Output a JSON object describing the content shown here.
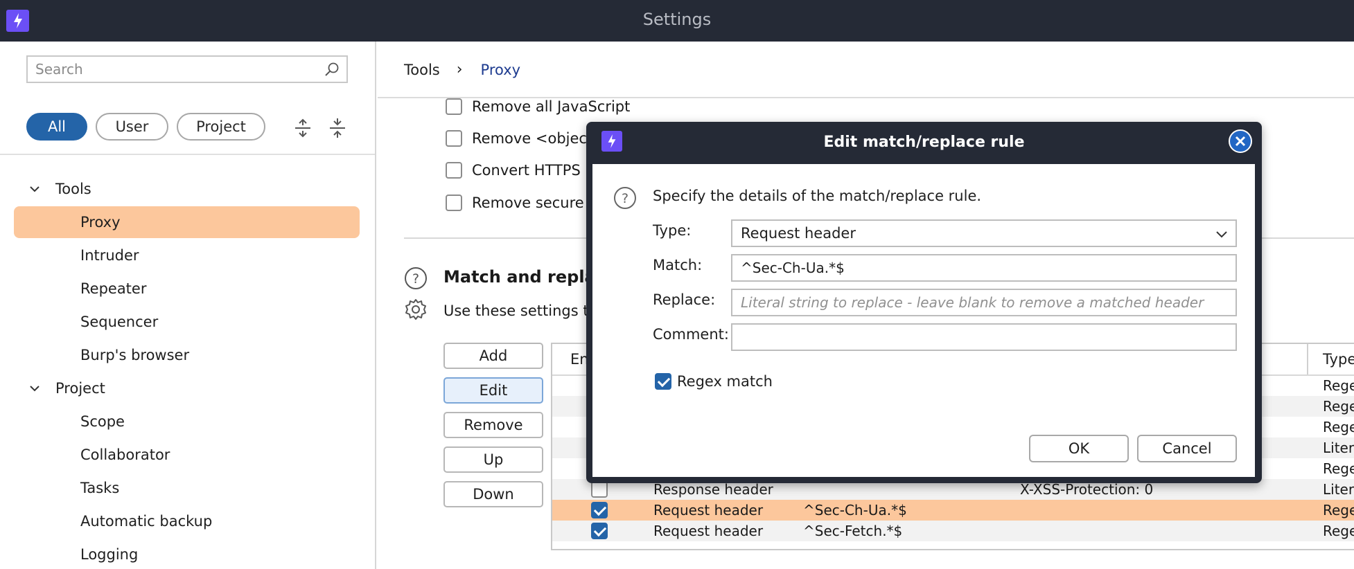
{
  "window": {
    "title": "Settings"
  },
  "sidebar": {
    "search_placeholder": "Search",
    "filters": [
      {
        "label": "All",
        "active": true
      },
      {
        "label": "User",
        "active": false
      },
      {
        "label": "Project",
        "active": false
      }
    ],
    "tree": {
      "groups": [
        {
          "label": "Tools",
          "items": [
            "Proxy",
            "Intruder",
            "Repeater",
            "Sequencer",
            "Burp's browser"
          ]
        },
        {
          "label": "Project",
          "items": [
            "Scope",
            "Collaborator",
            "Tasks",
            "Automatic backup",
            "Logging"
          ]
        }
      ],
      "selected_item": "Proxy"
    }
  },
  "breadcrumb": {
    "root": "Tools",
    "separator": "›",
    "current": "Proxy"
  },
  "proxy_options": [
    "Remove all JavaScript",
    "Remove <object>",
    "Convert HTTPS lin",
    "Remove secure fla"
  ],
  "match_replace": {
    "title": "Match and replace",
    "description": "Use these settings to",
    "buttons": {
      "add": "Add",
      "edit": "Edit",
      "remove": "Remove",
      "up": "Up",
      "down": "Down"
    },
    "columns": {
      "enabled": "En",
      "type": "Type"
    },
    "rows": [
      {
        "enabled": false,
        "item": "",
        "match": "",
        "replace": "",
        "type": "Regex"
      },
      {
        "enabled": false,
        "item": "",
        "match": "",
        "replace": "",
        "type": "Regex"
      },
      {
        "enabled": false,
        "item": "",
        "match": "",
        "replace": "",
        "type": "Regex"
      },
      {
        "enabled": false,
        "item": "",
        "match": "",
        "replace": "",
        "type": "Literal"
      },
      {
        "enabled": false,
        "item": "",
        "match": "",
        "replace": "",
        "type": "Regex"
      },
      {
        "enabled": false,
        "item": "Response header",
        "match": "",
        "replace": "X-XSS-Protection: 0",
        "type": "Literal"
      },
      {
        "enabled": true,
        "item": "Request header",
        "match": "^Sec-Ch-Ua.*$",
        "replace": "",
        "type": "Regex"
      },
      {
        "enabled": true,
        "item": "Request header",
        "match": "^Sec-Fetch.*$",
        "replace": "",
        "type": "Regex"
      }
    ],
    "selected_row": 6
  },
  "dialog": {
    "title": "Edit match/replace rule",
    "description": "Specify the details of the match/replace rule.",
    "labels": {
      "type": "Type:",
      "match": "Match:",
      "replace": "Replace:",
      "comment": "Comment:"
    },
    "type_value": "Request header",
    "match_value": "^Sec-Ch-Ua.*$",
    "replace_value": "",
    "replace_placeholder": "Literal string to replace - leave blank to remove a matched header",
    "comment_value": "",
    "regex_label": "Regex match",
    "regex_checked": true,
    "ok_label": "OK",
    "cancel_label": "Cancel"
  },
  "colors": {
    "titlebar": "#252a36",
    "logo": "#6b4ff6",
    "accent": "#2464a8",
    "selection": "#fcc79c",
    "close_button": "#2166c4"
  }
}
